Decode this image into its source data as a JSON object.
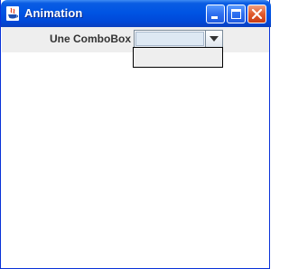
{
  "window": {
    "title": "Animation",
    "icon": "java-cup-icon",
    "controls": [
      "minimize-icon",
      "maximize-icon",
      "close-icon"
    ]
  },
  "form": {
    "combo_label": "Une ComboBox",
    "combo_value": "",
    "dropdown_open": true,
    "options": []
  },
  "colors": {
    "titlebar": "#0054e3",
    "toolbar_bg": "#eeeeee",
    "close_button": "#e05a2c"
  }
}
